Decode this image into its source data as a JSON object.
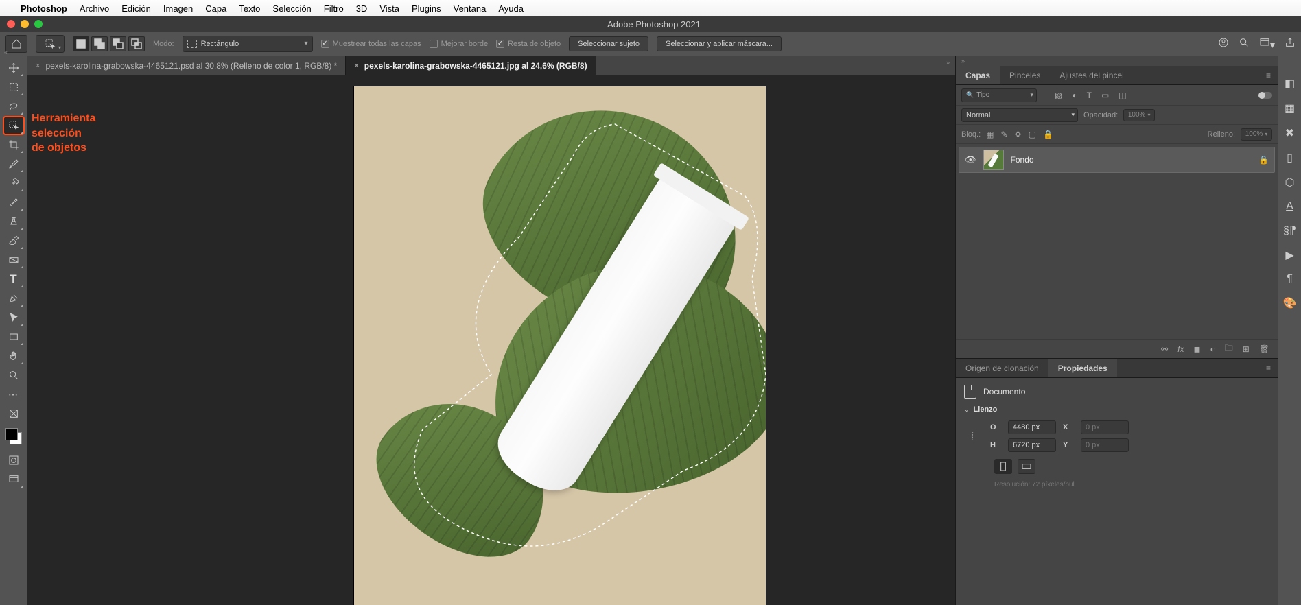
{
  "mac_menu": {
    "app": "Photoshop",
    "items": [
      "Archivo",
      "Edición",
      "Imagen",
      "Capa",
      "Texto",
      "Selección",
      "Filtro",
      "3D",
      "Vista",
      "Plugins",
      "Ventana",
      "Ayuda"
    ]
  },
  "window_title": "Adobe Photoshop 2021",
  "options_bar": {
    "mode_label": "Modo:",
    "mode_value": "Rectángulo",
    "sample_all": "Muestrear todas las capas",
    "enhance_edge": "Mejorar borde",
    "subtract_object": "Resta de objeto",
    "select_subject": "Seleccionar sujeto",
    "select_mask": "Seleccionar y aplicar máscara..."
  },
  "callout": "Herramienta selección de objetos",
  "doc_tabs": [
    {
      "label": "pexels-karolina-grabowska-4465121.psd al 30,8% (Relleno de color 1, RGB/8) *",
      "active": false
    },
    {
      "label": "pexels-karolina-grabowska-4465121.jpg al 24,6% (RGB/8)",
      "active": true
    }
  ],
  "right_tabs_top": {
    "tabs": [
      "Capas",
      "Pinceles",
      "Ajustes del pincel"
    ],
    "active": 0
  },
  "layers": {
    "filter_kind": "Tipo",
    "blend_mode": "Normal",
    "opacity_label": "Opacidad:",
    "opacity_value": "100%",
    "lock_label": "Bloq.:",
    "fill_label": "Relleno:",
    "fill_value": "100%",
    "items": [
      {
        "name": "Fondo",
        "locked": true
      }
    ]
  },
  "right_tabs_bottom": {
    "tabs": [
      "Origen de clonación",
      "Propiedades"
    ],
    "active": 1
  },
  "properties": {
    "doc_label": "Documento",
    "canvas_label": "Lienzo",
    "w_label": "O",
    "w_value": "4480 px",
    "h_label": "H",
    "h_value": "6720 px",
    "x_label": "X",
    "x_value": "0 px",
    "y_label": "Y",
    "y_value": "0 px",
    "resolution_hint": "Resolución: 72 píxeles/pul"
  }
}
